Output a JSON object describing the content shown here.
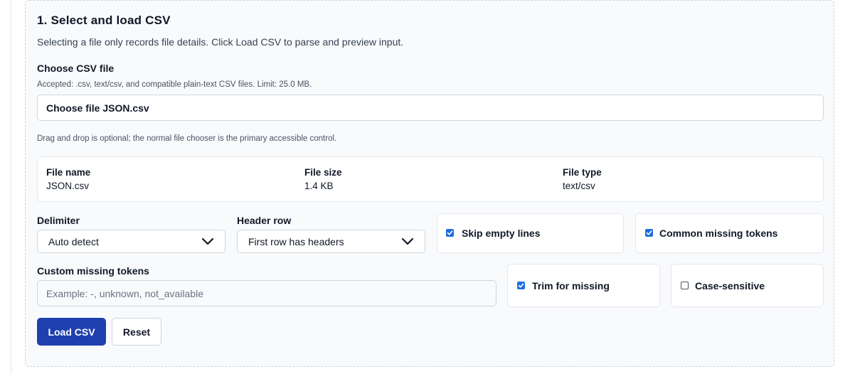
{
  "section": {
    "title": "1. Select and load CSV",
    "subtitle": "Selecting a file only records file details. Click Load CSV to parse and preview input."
  },
  "file_chooser": {
    "label": "Choose CSV file",
    "accepted_hint": "Accepted: .csv, text/csv, and compatible plain-text CSV files. Limit: 25.0 MB.",
    "button_text": "Choose file JSON.csv",
    "dragdrop_hint": "Drag and drop is optional; the normal file chooser is the primary accessible control."
  },
  "file_info": {
    "name_label": "File name",
    "name_value": "JSON.csv",
    "size_label": "File size",
    "size_value": "1.4 KB",
    "type_label": "File type",
    "type_value": "text/csv"
  },
  "delimiter": {
    "label": "Delimiter",
    "selected": "Auto detect"
  },
  "header_row": {
    "label": "Header row",
    "selected": "First row has headers"
  },
  "options": {
    "skip_empty": {
      "label": "Skip empty lines",
      "checked": true
    },
    "common_missing": {
      "label": "Common missing tokens",
      "checked": true
    },
    "trim_missing": {
      "label": "Trim for missing",
      "checked": true
    },
    "case_sensitive": {
      "label": "Case-sensitive",
      "checked": false
    }
  },
  "custom_missing": {
    "label": "Custom missing tokens",
    "value": "",
    "placeholder": "Example: -, unknown, not_available"
  },
  "actions": {
    "load_label": "Load CSV",
    "reset_label": "Reset"
  },
  "colors": {
    "primary_button": "#1e40af",
    "checkbox_checked": "#1d6fe0",
    "panel_background": "#f8fafc"
  },
  "icons": {
    "select_arrow": "chevron-down-icon",
    "checkmark": "check-icon"
  }
}
